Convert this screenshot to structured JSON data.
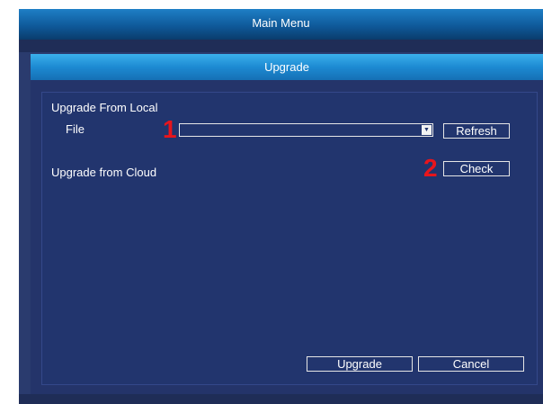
{
  "window": {
    "title": "Main Menu"
  },
  "dialog": {
    "title": "Upgrade"
  },
  "local": {
    "section_label": "Upgrade From Local",
    "file_label": "File",
    "file_value": "",
    "refresh_label": "Refresh"
  },
  "cloud": {
    "section_label": "Upgrade from Cloud",
    "check_label": "Check"
  },
  "footer": {
    "upgrade_label": "Upgrade",
    "cancel_label": "Cancel"
  },
  "annotations": {
    "marker_1": "1",
    "marker_2": "2"
  },
  "colors": {
    "marker": "#e8151c",
    "background": "#22356e",
    "title_bar": "#1d8ad2"
  },
  "icons": {
    "dropdown": "chevron-down-icon"
  }
}
